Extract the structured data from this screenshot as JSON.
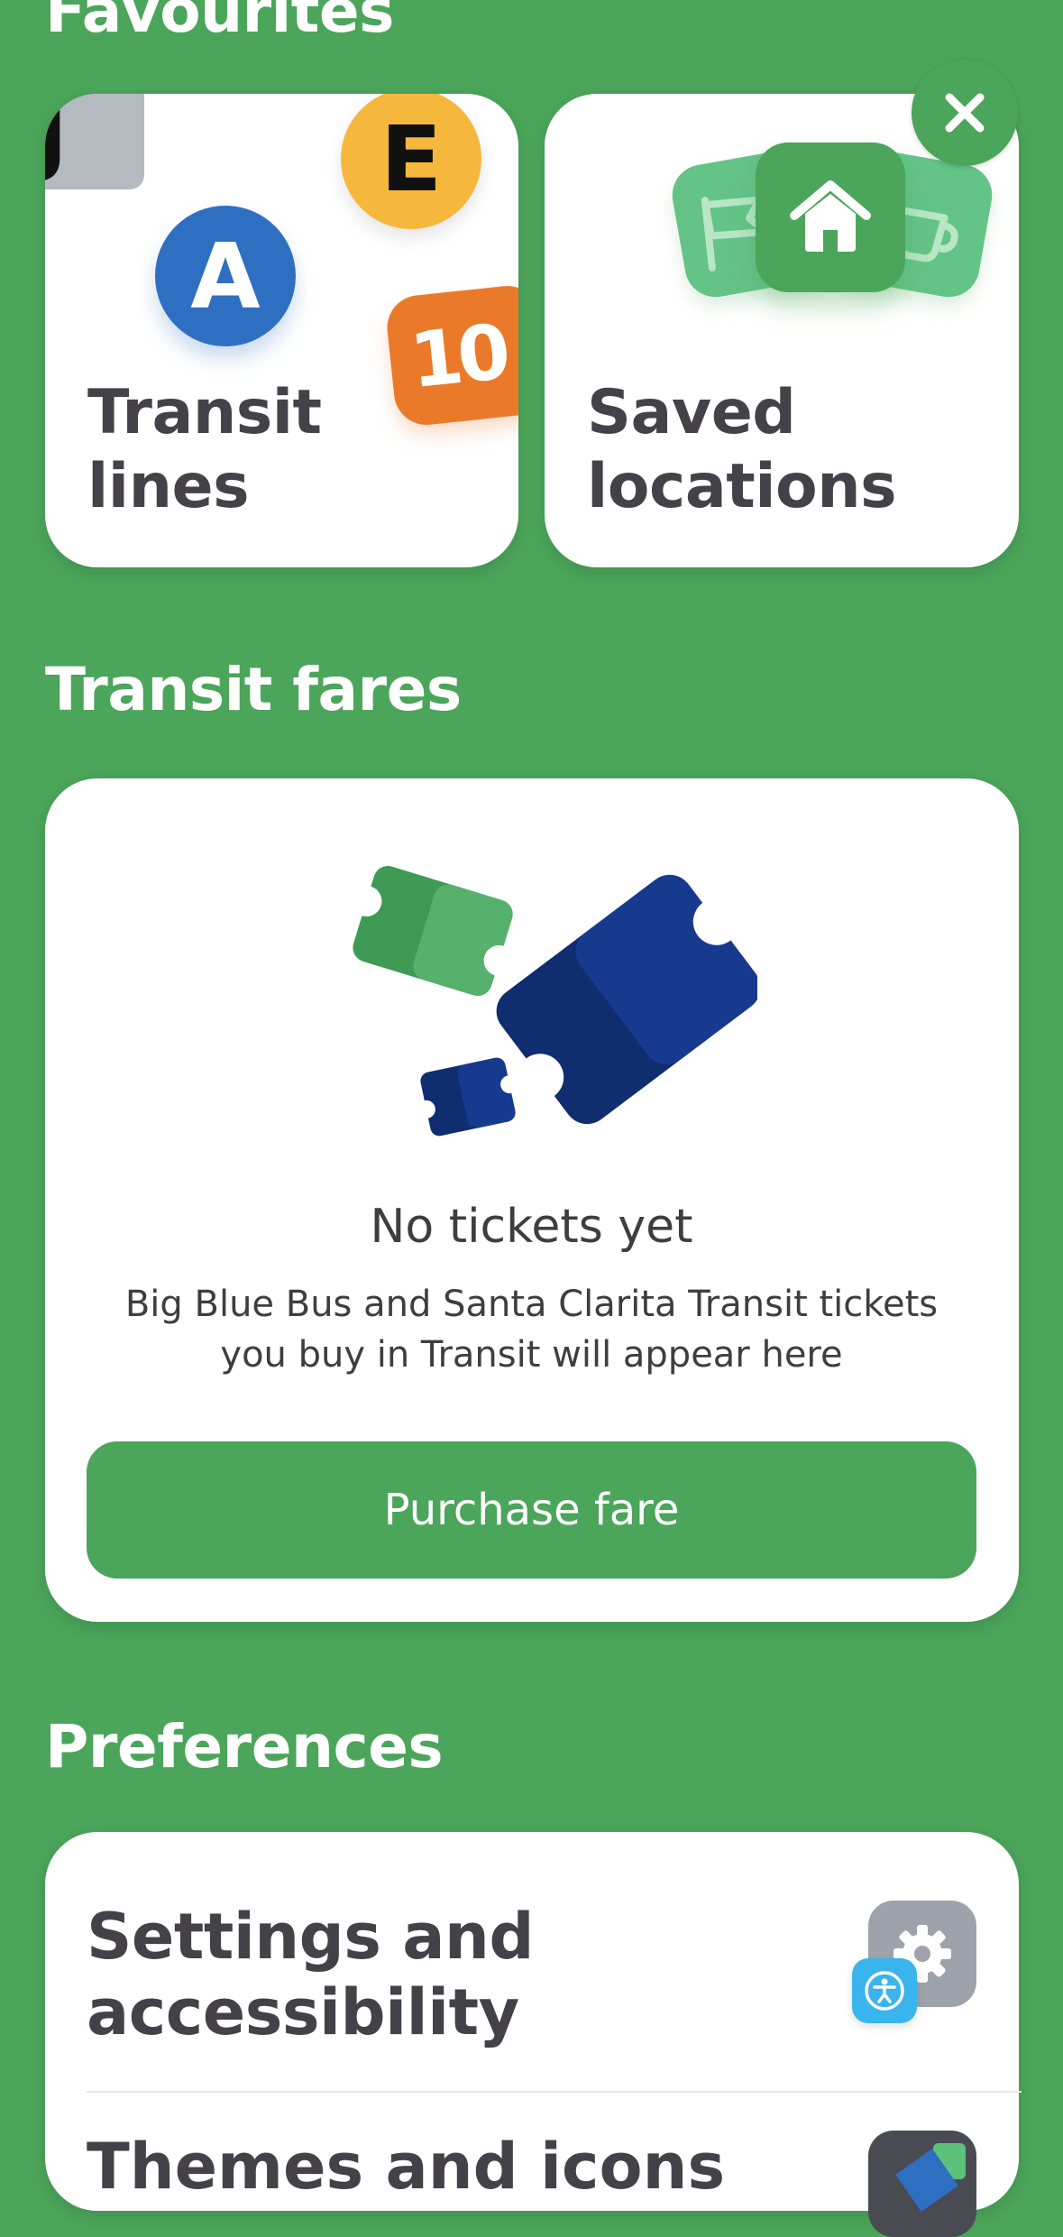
{
  "sections": {
    "favourites_title": "Favourites",
    "fares_title": "Transit fares",
    "preferences_title": "Preferences"
  },
  "favourites": {
    "transit_lines": {
      "label": "Transit lines",
      "badges": [
        {
          "text": "J",
          "color": "#b5bac0"
        },
        {
          "text": "E",
          "color": "#f5b83d"
        },
        {
          "text": "A",
          "color": "#2f6fc1"
        },
        {
          "text": "10",
          "color": "#ea7a2a"
        }
      ]
    },
    "saved_locations": {
      "label": "Saved locations",
      "icon": "home-icon"
    },
    "close_icon": "close-icon"
  },
  "fares": {
    "empty_title": "No tickets yet",
    "empty_description": "Big Blue Bus and Santa Clarita Transit tickets you buy in Transit will appear here",
    "purchase_label": "Purchase fare"
  },
  "preferences": {
    "items": [
      {
        "label": "Settings and accessibility",
        "icon": "gear-icon",
        "badge_icon": "accessibility-icon"
      },
      {
        "label": "Themes and icons",
        "icon": "theme-icon"
      }
    ]
  },
  "colors": {
    "background": "#4ba55a",
    "accent": "#4ba55a",
    "ticket_blue": "#173a8f",
    "ticket_green": "#3f9a55",
    "text_dark": "#444248"
  }
}
